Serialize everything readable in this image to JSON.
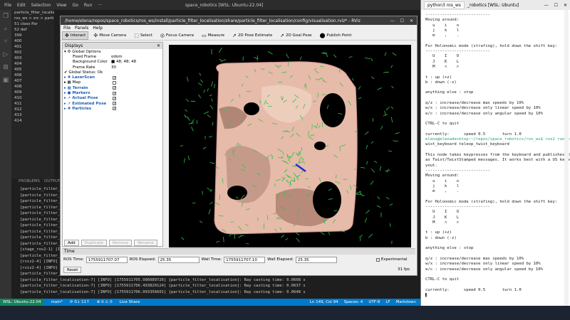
{
  "vscode": {
    "menu": [
      "File",
      "Edit",
      "Selection",
      "View",
      "Go",
      "Run",
      "···"
    ],
    "title": "space_robotics [WSL: Ubuntu-22.04]",
    "sidebar": [
      "particle_filter_localisation.py",
      "ros_ws > src > particle",
      "51   class Par",
      "52      def",
      "399",
      "400",
      "401",
      "402",
      "403",
      "404",
      "405",
      "406",
      "407",
      "408",
      "409",
      "410",
      "411",
      "412",
      "413",
      "414"
    ],
    "panel_tabs": [
      "PROBLEMS",
      "OUTPUT"
    ],
    "panel_lines": [
      "[particle_filter_l",
      "[particle_filter_l",
      "[particle_filter_l",
      "[particle_filter_l",
      "[particle_filter_l",
      "[particle_filter_l",
      "[particle_filter_l",
      "[particle_filter_l",
      "[particle_filter_l",
      "[particle_filter_l",
      "[stage_ros2-1] [IN",
      "[particle_filter_l",
      "[rviz2-4] [INFO]",
      "[rviz2-4] [INFO]",
      "[particle_filter_l",
      "[particle_filter_localisation-7] [INFO] [1755911705.986089726] [particle_filter_localisation]: Ray casting time: 0.0608 s",
      "[particle_filter_localisation-7] [INFO] [1755911706.493820124] [particle_filter_localisation]: Ray casting time: 0.0637 s",
      "[particle_filter_localisation-7] [INFO] [1755911706.993356601] [particle_filter_localisation]: Ray casting time: 0.0648 s"
    ],
    "status": {
      "wsl": "WSL: Ubuntu-22.04",
      "branch": "main*",
      "sync": "⟳ 0↓ 11↑",
      "errors": "⊗ 0 ⚠ 0",
      "live": "Live Share",
      "pos": "Ln 149, Col 94",
      "spaces": "Spaces: 4",
      "enc": "UTF-8",
      "eol": "LF",
      "lang": "Markdown"
    }
  },
  "rviz": {
    "title": "/home/elena/repos/space_robotics/ros_ws/install/particle_filter_localisation/share/particle_filter_localisation/config/visualisation.rviz* - RViz",
    "menu": [
      "File",
      "Panels",
      "Help"
    ],
    "tools": [
      {
        "icon": "✥",
        "label": "Interact",
        "active": true
      },
      {
        "icon": "✣",
        "label": "Move Camera",
        "active": false
      },
      {
        "icon": "⬚",
        "label": "Select",
        "active": false
      },
      {
        "icon": "◎",
        "label": "Focus Camera",
        "active": false
      },
      {
        "icon": "▭",
        "label": "Measure",
        "active": false
      },
      {
        "icon": "➚",
        "label": "2D Pose Estimate",
        "active": false
      },
      {
        "icon": "➚",
        "label": "2D Goal Pose",
        "active": false
      },
      {
        "icon": "⬤",
        "label": "Publish Point",
        "active": false
      }
    ],
    "displays_title": "Displays",
    "rows": [
      {
        "label": "▾ ⚙ Global Options",
        "value": "",
        "indent": 2,
        "cls": ""
      },
      {
        "label": "Fixed Frame",
        "value": "odom",
        "indent": 14,
        "cls": ""
      },
      {
        "label": "Background Color",
        "value": "■ 48; 48; 48",
        "indent": 14,
        "cls": ""
      },
      {
        "label": "Frame Rate",
        "value": "30",
        "indent": 14,
        "cls": ""
      },
      {
        "label": "✔ Global Status: Ok",
        "value": "",
        "indent": 2,
        "cls": ""
      },
      {
        "label": "▸ ✚ LaserScan",
        "value": "",
        "indent": 2,
        "cls": "blue",
        "check": true
      },
      {
        "label": "▸ ▦ Map",
        "value": "",
        "indent": 2,
        "cls": "",
        "check": false
      },
      {
        "label": "▸ ▦ Terrain",
        "value": "",
        "indent": 2,
        "cls": "blue",
        "check": true
      },
      {
        "label": "▸ ● Markers",
        "value": "",
        "indent": 2,
        "cls": "blue",
        "check": true
      },
      {
        "label": "▸ ➚ Actual Pose",
        "value": "",
        "indent": 2,
        "cls": "blue",
        "check": true
      },
      {
        "label": "▸ ➚ Estimated Pose",
        "value": "",
        "indent": 2,
        "cls": "blue",
        "check": true
      },
      {
        "label": "▸ ✚ Particles",
        "value": "",
        "indent": 2,
        "cls": "blue",
        "check": true
      }
    ],
    "buttons": [
      {
        "label": "Add",
        "enabled": true
      },
      {
        "label": "Duplicate",
        "enabled": false
      },
      {
        "label": "Remove",
        "enabled": false
      },
      {
        "label": "Rename",
        "enabled": false
      }
    ],
    "time": {
      "header": "Time",
      "ros_time_label": "ROS Time:",
      "ros_time": "1755911707.07",
      "ros_elapsed_label": "ROS Elapsed:",
      "ros_elapsed": "25.35",
      "wall_time_label": "Wall Time:",
      "wall_time": "1755911707.10",
      "wall_elapsed_label": "Wall Elapsed:",
      "wall_elapsed": "25.35",
      "experimental": "Experimental",
      "reset": "Reset",
      "fps": "31 fps"
    }
  },
  "terminal": {
    "tab": "python3 ros_ws",
    "title": "_robotics [WSL: Ubuntu]",
    "lines": [
      "---------------------------",
      "Moving around:",
      "   u    i    o",
      "   j    k    l",
      "   m    ,    .",
      "",
      "For Holonomic mode (strafing), hold down the shift key:",
      "---------------------------",
      "   U    I    O",
      "   J    K    L",
      "   M    <    >",
      "",
      "t : up (+z)",
      "b : down (-z)",
      "",
      "anything else : stop",
      "",
      "q/z : increase/decrease max speeds by 10%",
      "w/x : increase/decrease only linear speed by 10%",
      "e/c : increase/decrease only angular speed by 10%",
      "",
      "CTRL-C to quit",
      "",
      "currently:      speed 0.5       turn 1.0",
      "elena@elenadesktop:~/repos/space_robotics/ros_ws$ ros2 run teleop_t",
      "wist_keyboard teleop_twist_keyboard",
      "",
      "This node takes keypresses from the keyboard and publishes them",
      "as Twist/TwistStamped messages. It works best with a US keyboard la",
      "yout.",
      "---------------------------",
      "Moving around:",
      "   u    i    o",
      "   j    k    l",
      "   m    ,    .",
      "",
      "For Holonomic mode (strafing), hold down the shift key:",
      "---------------------------",
      "   U    I    O",
      "   J    K    L",
      "   M    <    >",
      "",
      "t : up (+z)",
      "b : down (-z)",
      "",
      "anything else : stop",
      "",
      "q/z : increase/decrease max speeds by 10%",
      "w/x : increase/decrease only linear speed by 10%",
      "e/c : increase/decrease only angular speed by 10%",
      "",
      "CTRL-C to quit",
      "",
      "currently:      speed 0.5       turn 1.0",
      "▌"
    ]
  },
  "colors": {
    "map_base": "#e8bfae",
    "map_dark": "#7a5248",
    "map_mid": "#b88a7c",
    "particles": "#35c24a",
    "pose": "#1a2bd6"
  }
}
